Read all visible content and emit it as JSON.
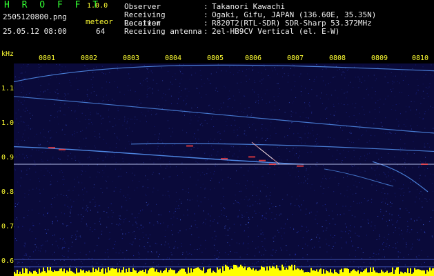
{
  "header": {
    "app_title": "H R O F F T",
    "app_version": "1.0.0",
    "file_name": "2505120800.png",
    "meteor_label": "meteor",
    "date_time": "25.05.12 08:00",
    "meteor_count": "64"
  },
  "info": {
    "rows": [
      {
        "label": "Observer",
        "sep": ":",
        "value": "Takanori Kawachi"
      },
      {
        "label": "Receiving Location",
        "sep": ":",
        "value": "Ogaki, Gifu, JAPAN (136.60E, 35.35N)"
      },
      {
        "label": "Receiver",
        "sep": ":",
        "value": "R820T2(RTL-SDR) SDR-Sharp 53.372MHz"
      },
      {
        "label": "Receiving antenna",
        "sep": ":",
        "value": "2el-HB9CV Vertical (el. E-W)"
      }
    ]
  },
  "chart_data": {
    "type": "heatmap",
    "ylabel": "kHz",
    "y_ticks": [
      "1.1",
      "1.0",
      "0.9",
      "0.8",
      "0.7",
      "0.6"
    ],
    "x_ticks": [
      "0801",
      "0802",
      "0803",
      "0804",
      "0805",
      "0806",
      "0807",
      "0808",
      "0809",
      "0810"
    ],
    "x_range_minutes": [
      0,
      10
    ],
    "y_range_khz": [
      0.58,
      1.16
    ],
    "carrier_khz": 0.885,
    "colors": {
      "background": "#0a0a3a",
      "noise": "#2a3cc8",
      "trace": "#5a9cff",
      "hot": "#ff4040",
      "baseline": "#ffff00",
      "carrier": "#c8d2ff"
    }
  },
  "colors": {
    "accent_green": "#33ff33",
    "label_yellow": "#ffff33",
    "text_white": "#f0f0f0"
  }
}
